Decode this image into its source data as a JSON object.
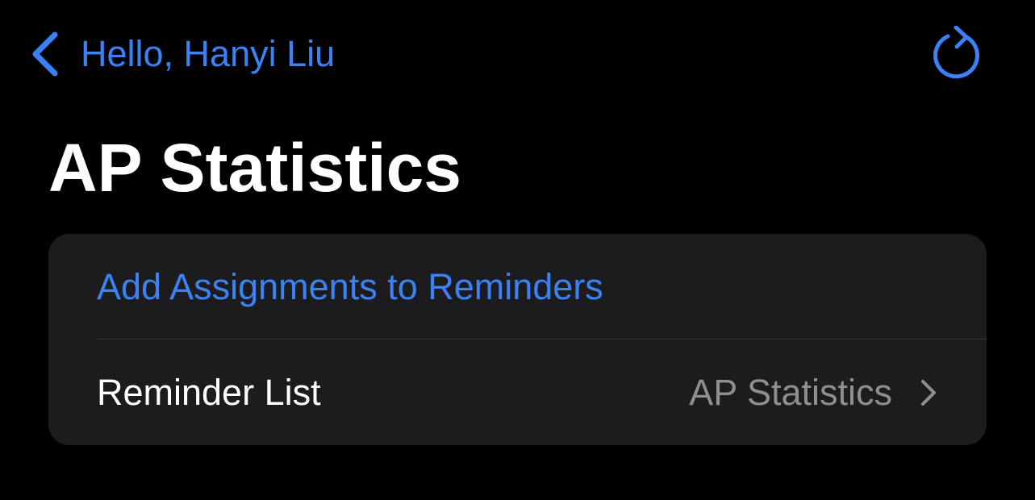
{
  "colors": {
    "background": "#000000",
    "card_background": "#1c1c1e",
    "accent": "#3b82f6",
    "primary_text": "#ffffff",
    "secondary_text": "#8e8e93",
    "divider": "#3a3a3c"
  },
  "nav": {
    "back_icon": "chevron-left-icon",
    "back_label": "Hello, Hanyi Liu",
    "refresh_icon": "refresh-icon"
  },
  "page": {
    "title": "AP Statistics"
  },
  "settings": {
    "add_assignments_label": "Add Assignments to Reminders",
    "reminder_list": {
      "label": "Reminder List",
      "value": "AP Statistics",
      "chevron_icon": "chevron-right-icon"
    }
  }
}
